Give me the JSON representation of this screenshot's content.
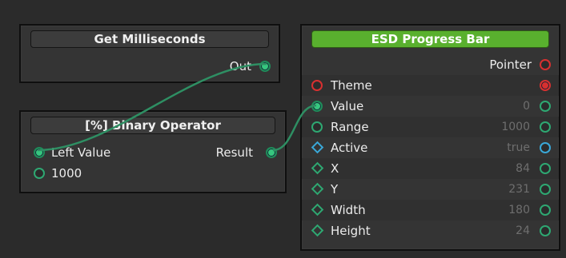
{
  "colors": {
    "link": "#2e8f63",
    "accent_green": "#59b02e",
    "port_green": "#37c77f",
    "port_red": "#d83030",
    "port_cyan": "#3aa8d8"
  },
  "nodes": {
    "get_ms": {
      "title": "Get Milliseconds",
      "outputs": [
        {
          "label": "Out"
        }
      ]
    },
    "binary_op": {
      "title": "[%] Binary Operator",
      "inputs": [
        {
          "label": "Left Value"
        },
        {
          "label": "1000"
        }
      ],
      "outputs": [
        {
          "label": "Result"
        }
      ]
    },
    "progress_bar": {
      "title": "ESD Progress Bar",
      "outputs": [
        {
          "label": "Pointer"
        }
      ],
      "inputs": [
        {
          "label": "Theme",
          "value": ""
        },
        {
          "label": "Value",
          "value": "0"
        },
        {
          "label": "Range",
          "value": "1000"
        },
        {
          "label": "Active",
          "value": "true"
        },
        {
          "label": "X",
          "value": "84"
        },
        {
          "label": "Y",
          "value": "231"
        },
        {
          "label": "Width",
          "value": "180"
        },
        {
          "label": "Height",
          "value": "24"
        }
      ]
    }
  }
}
